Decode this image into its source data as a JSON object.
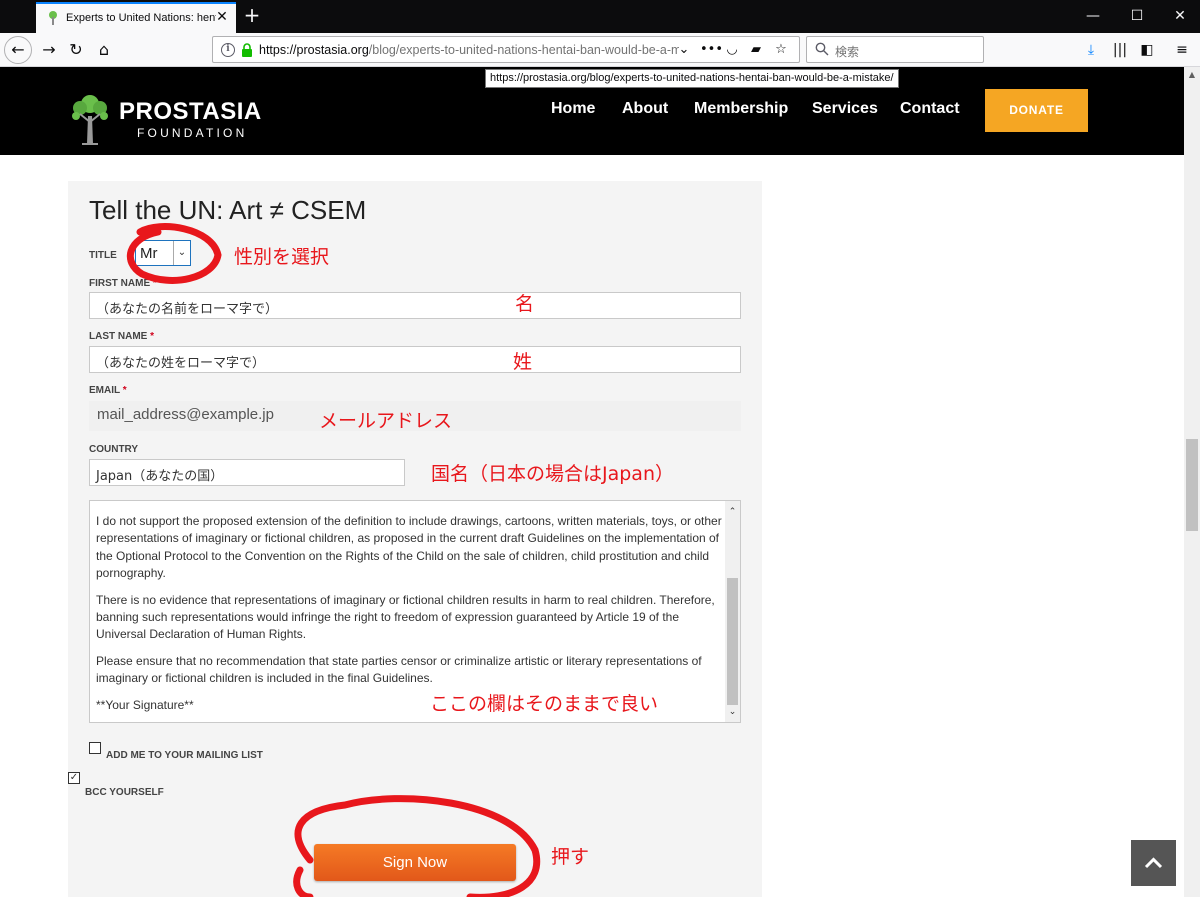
{
  "browser": {
    "tab_title": "Experts to United Nations: hentai ban would be a mistake",
    "url_host": "https://prostasia.org",
    "url_path": "/blog/experts-to-united-nations-hentai-ban-would-be-a-mistake/",
    "url_tooltip": "https://prostasia.org/blog/experts-to-united-nations-hentai-ban-would-be-a-mistake/",
    "search_placeholder": "検索"
  },
  "site": {
    "logo_name": "PROSTASIA",
    "logo_sub": "FOUNDATION",
    "nav": [
      "Home",
      "About",
      "Membership",
      "Services",
      "Contact"
    ],
    "donate_label": "DONATE",
    "brand_color": "#f5a623"
  },
  "form": {
    "title": "Tell the UN: Art ≠ CSEM",
    "title_label": "TITLE",
    "title_value": "Mr",
    "first_name_label": "FIRST NAME",
    "first_name_value": "（あなたの名前をローマ字で）",
    "last_name_label": "LAST NAME",
    "last_name_value": "（あなたの姓をローマ字で）",
    "email_label": "EMAIL",
    "email_value": "mail_address@example.jp",
    "country_label": "COUNTRY",
    "country_value": "Japan（あなたの国）",
    "required_mark": "*",
    "message": [
      "I do not support the proposed extension of the definition to include drawings, cartoons, written materials, toys, or other representations of imaginary or fictional children, as proposed in the current draft Guidelines on the implementation of the Optional Protocol to the Convention on the Rights of the Child on the sale of children, child prostitution and child pornography.",
      "There is no evidence that representations of imaginary or fictional children results in harm to real children. Therefore, banning such representations would infringe the right to freedom of expression guaranteed by Article 19 of the Universal Declaration of Human Rights.",
      "Please ensure that no recommendation that state parties censor or criminalize artistic or literary representations of imaginary or fictional children is included in the final Guidelines.",
      "**Your Signature**"
    ],
    "mailing_list_label": "ADD ME TO YOUR MAILING LIST",
    "mailing_list_checked": false,
    "bcc_label": "BCC YOURSELF",
    "bcc_checked": true,
    "submit_label": "Sign Now"
  },
  "annotations": {
    "title_note": "性別を選択",
    "first_name_note": "名",
    "last_name_note": "姓",
    "email_note": "メールアドレス",
    "country_note": "国名（日本の場合はJapan）",
    "message_note": "ここの欄はそのままで良い",
    "submit_note": "押す",
    "color": "#e8171c"
  }
}
